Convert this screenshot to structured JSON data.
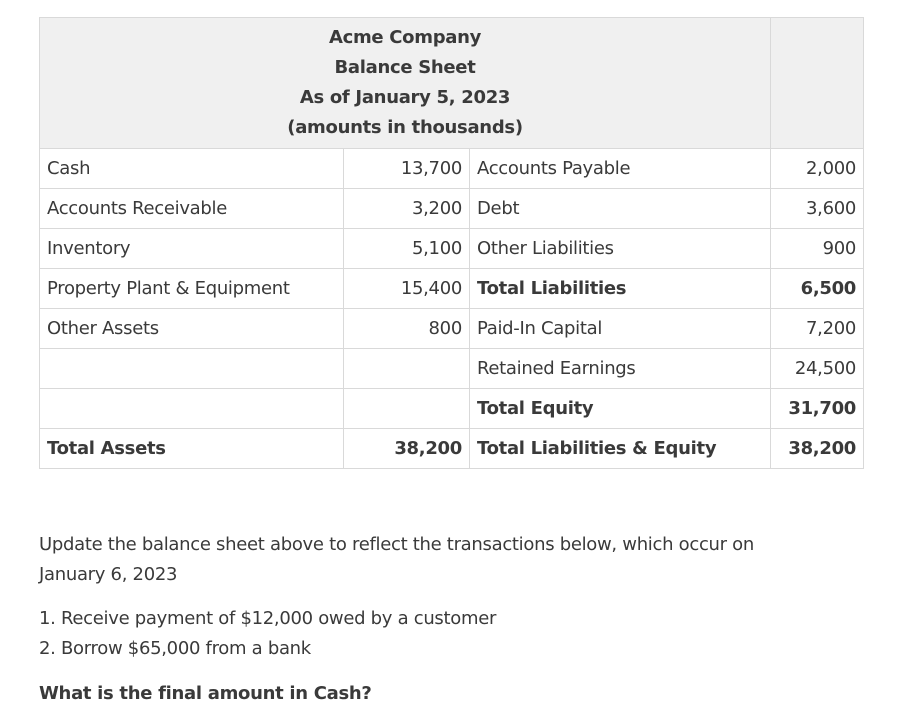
{
  "header": {
    "company": "Acme Company",
    "title": "Balance Sheet",
    "date": "As of January 5, 2023",
    "units": "(amounts in thousands)"
  },
  "rows": [
    {
      "asset_label": "Cash",
      "asset_value": "13,700",
      "liab_label": "Accounts Payable",
      "liab_value": "2,000"
    },
    {
      "asset_label": "Accounts Receivable",
      "asset_value": "3,200",
      "liab_label": "Debt",
      "liab_value": "3,600"
    },
    {
      "asset_label": "Inventory",
      "asset_value": "5,100",
      "liab_label": "Other Liabilities",
      "liab_value": "900"
    },
    {
      "asset_label": "Property Plant & Equipment",
      "asset_value": "15,400",
      "liab_label": "Total Liabilities",
      "liab_value": "6,500"
    },
    {
      "asset_label": "Other Assets",
      "asset_value": "800",
      "liab_label": "Paid-In Capital",
      "liab_value": "7,200"
    },
    {
      "asset_label": "",
      "asset_value": "",
      "liab_label": "Retained Earnings",
      "liab_value": "24,500"
    },
    {
      "asset_label": "",
      "asset_value": "",
      "liab_label": "Total Equity",
      "liab_value": "31,700"
    },
    {
      "asset_label": "Total Assets",
      "asset_value": "38,200",
      "liab_label": "Total Liabilities & Equity",
      "liab_value": "38,200"
    }
  ],
  "instructions": {
    "line1": "Update the balance sheet above to reflect the transactions below, which occur on",
    "line2": "January 6, 2023"
  },
  "transactions": [
    "1. Receive payment of $12,000 owed by a customer",
    "2. Borrow $65,000 from a bank"
  ],
  "question": "What is the final amount in Cash?"
}
